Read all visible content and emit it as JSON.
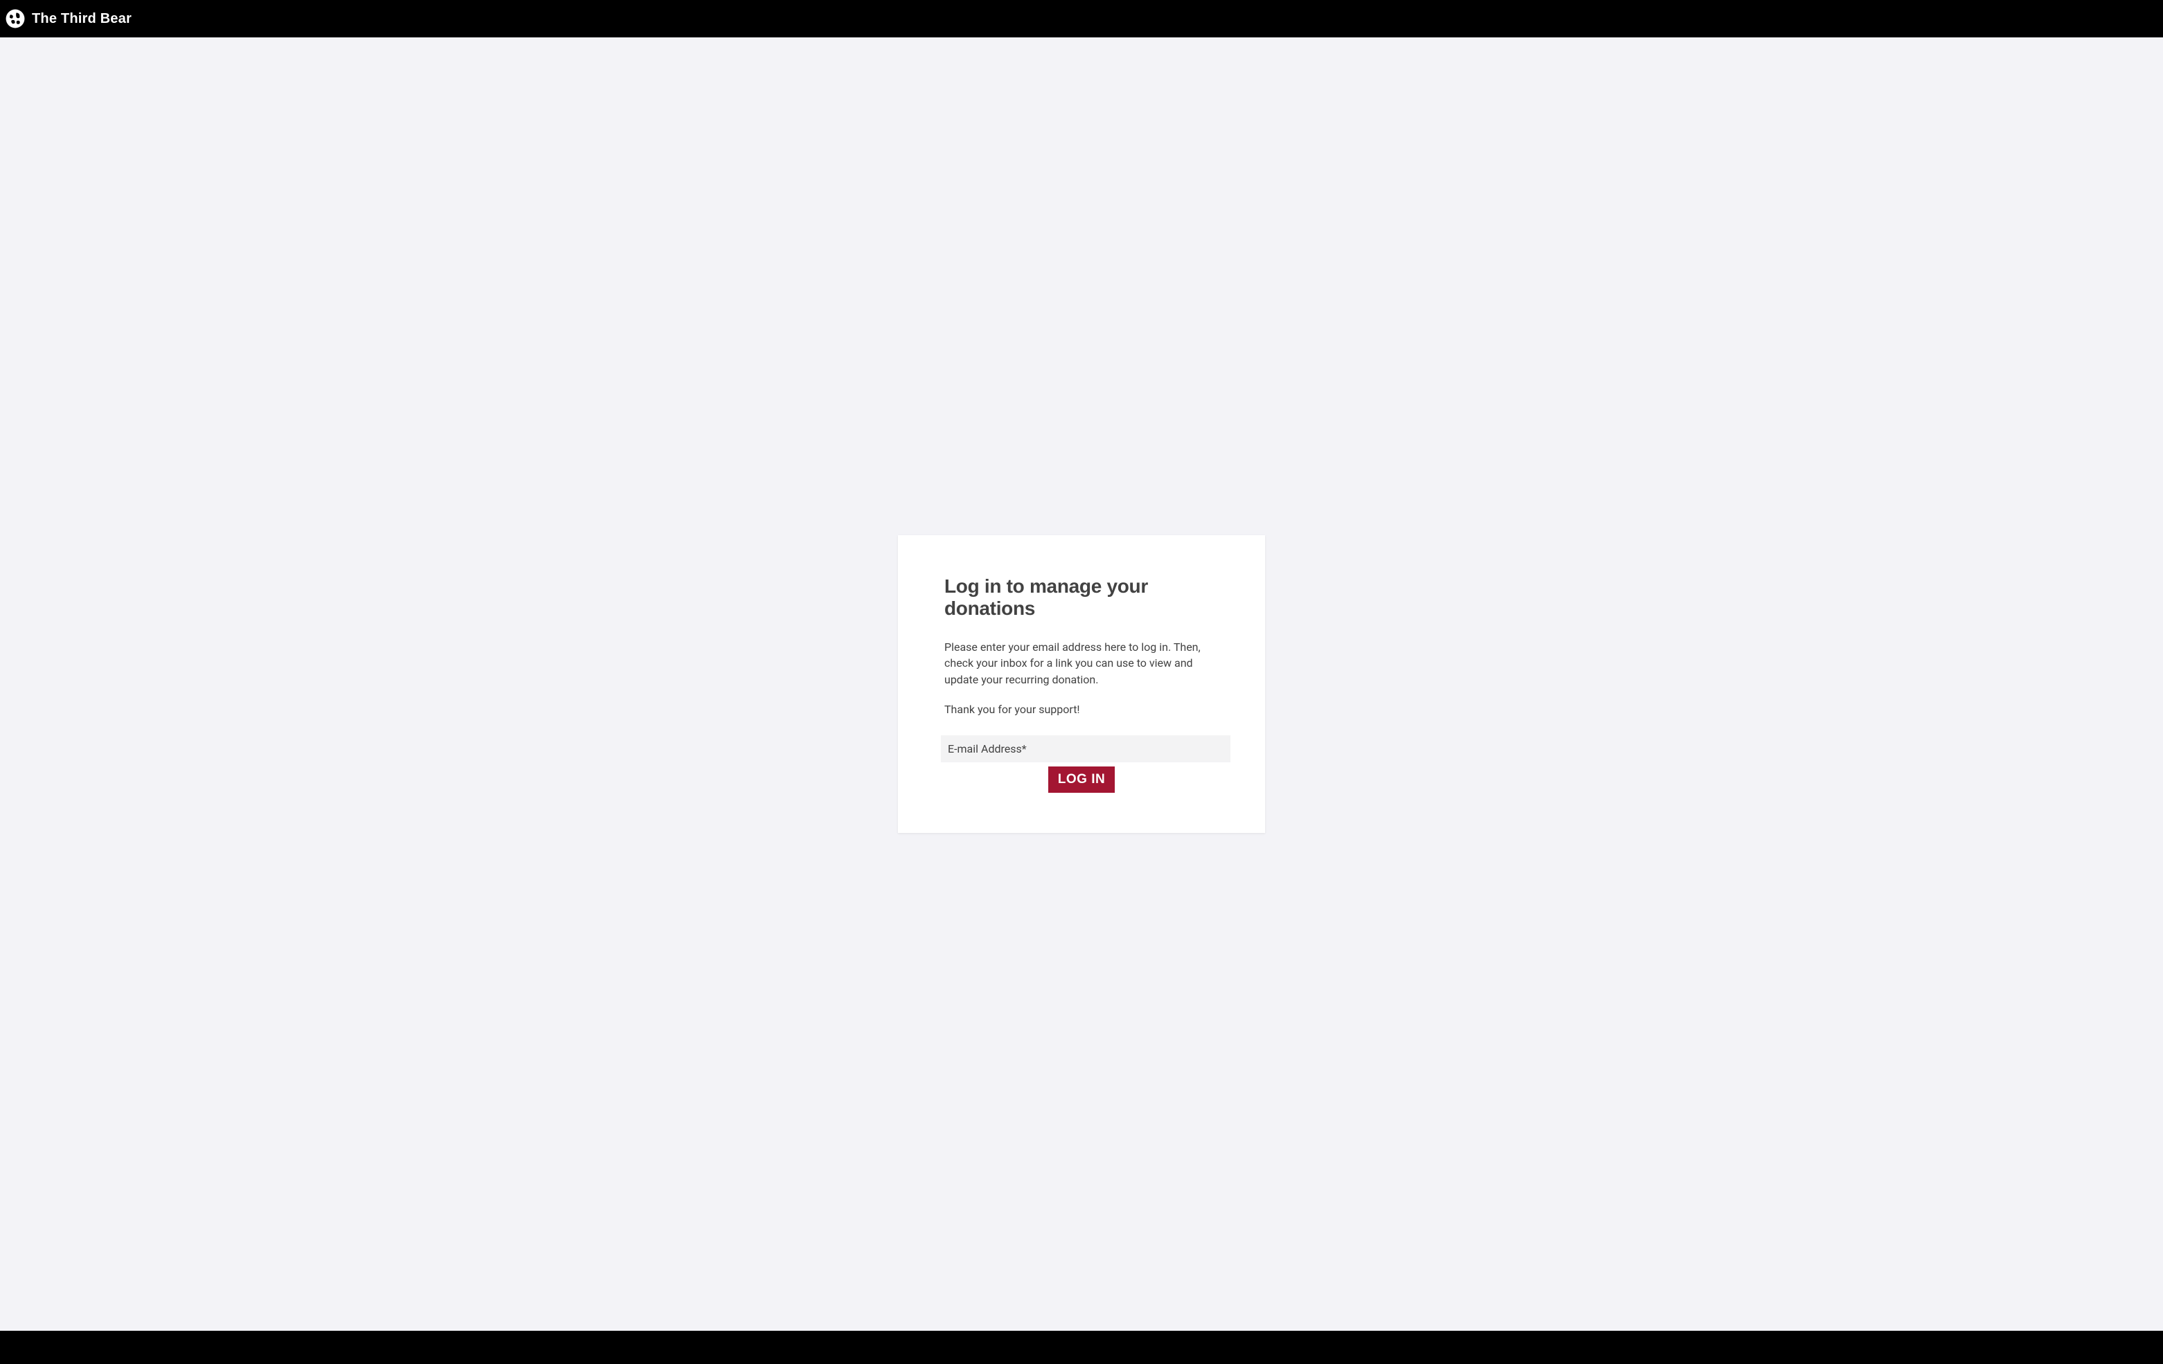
{
  "header": {
    "site_name": "The Third Bear"
  },
  "card": {
    "title": "Log in to manage your donations",
    "description": "Please enter your email address here to log in. Then, check your inbox for a link you can use to view and update your recurring donation.",
    "thanks": "Thank you for your support!",
    "email_placeholder": "E-mail Address*",
    "login_button": "LOG IN"
  }
}
